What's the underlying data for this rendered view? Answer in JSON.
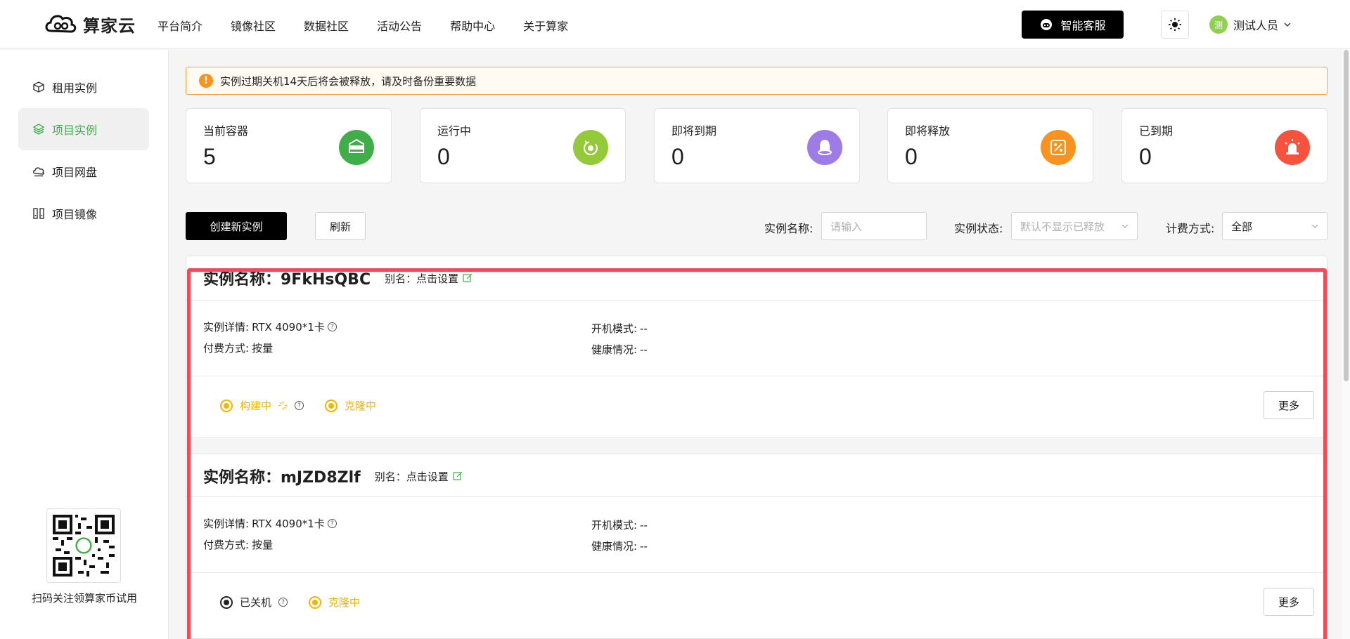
{
  "header": {
    "logo_text": "算家云",
    "nav": [
      "平台简介",
      "镜像社区",
      "数据社区",
      "活动公告",
      "帮助中心",
      "关于算家"
    ],
    "customer_service_label": "智能客服",
    "user_avatar_text": "测",
    "user_name": "测试人员"
  },
  "sidebar": {
    "items": [
      {
        "label": "租用实例",
        "icon": "cube-icon"
      },
      {
        "label": "项目实例",
        "icon": "layers-icon",
        "active": true
      },
      {
        "label": "项目网盘",
        "icon": "cloud-drive-icon"
      },
      {
        "label": "项目镜像",
        "icon": "image-mirror-icon"
      }
    ],
    "qr_caption": "扫码关注领算家币试用"
  },
  "notice": {
    "text": "实例过期关机14天后将会被释放，请及时备份重要数据"
  },
  "stats": [
    {
      "label": "当前容器",
      "value": "5",
      "color": "#3fae49",
      "icon": "container-icon"
    },
    {
      "label": "运行中",
      "value": "0",
      "color": "#94c93a",
      "icon": "running-icon"
    },
    {
      "label": "即将到期",
      "value": "0",
      "color": "#9e7ce8",
      "icon": "bell-icon"
    },
    {
      "label": "即将释放",
      "value": "0",
      "color": "#f7931e",
      "icon": "release-icon"
    },
    {
      "label": "已到期",
      "value": "0",
      "color": "#f5533d",
      "icon": "alarm-icon"
    }
  ],
  "toolbar": {
    "create_label": "创建新实例",
    "refresh_label": "刷新",
    "name_label": "实例名称:",
    "name_placeholder": "请输入",
    "status_label": "实例状态:",
    "status_placeholder": "默认不显示已释放",
    "billing_label": "计费方式:",
    "billing_value": "全部"
  },
  "instances": [
    {
      "title": "实例名称：9FkHsQBC",
      "alias": "别名：点击设置",
      "detail_label": "实例详情:",
      "detail_value": "RTX 4090*1卡",
      "pay_label": "付费方式:",
      "pay_value": "按量",
      "boot_label": "开机模式:",
      "boot_value": "--",
      "health_label": "健康情况:",
      "health_value": "--",
      "statuses": [
        {
          "label": "构建中",
          "color": "#f5b400",
          "extra": "spinner"
        },
        {
          "label": "克隆中",
          "color": "#f5b400"
        }
      ],
      "more_label": "更多"
    },
    {
      "title": "实例名称：mJZD8Zlf",
      "alias": "别名：点击设置",
      "detail_label": "实例详情:",
      "detail_value": "RTX 4090*1卡",
      "pay_label": "付费方式:",
      "pay_value": "按量",
      "boot_label": "开机模式:",
      "boot_value": "--",
      "health_label": "健康情况:",
      "health_value": "--",
      "statuses": [
        {
          "label": "已关机",
          "color": "#222222"
        },
        {
          "label": "克隆中",
          "color": "#f5b400"
        }
      ],
      "more_label": "更多"
    }
  ]
}
